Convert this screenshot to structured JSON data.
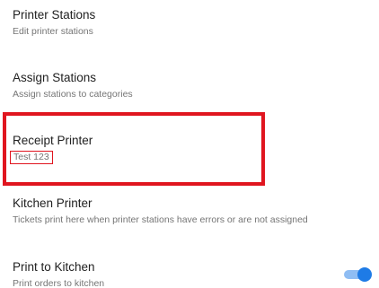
{
  "settings": {
    "items": [
      {
        "title": "Printer Stations",
        "subtitle": "Edit printer stations"
      },
      {
        "title": "Assign Stations",
        "subtitle": "Assign stations to categories"
      },
      {
        "title": "Receipt Printer",
        "subtitle": "Test 123"
      },
      {
        "title": "Kitchen Printer",
        "subtitle": "Tickets print here when printer stations have errors or are not assigned"
      },
      {
        "title": "Print to Kitchen",
        "subtitle": "Print orders to kitchen",
        "toggle_on": true
      }
    ]
  },
  "colors": {
    "highlight": "#e0151f",
    "toggle_active": "#1e7be6",
    "title_text": "#212121",
    "subtitle_text": "#757575"
  }
}
